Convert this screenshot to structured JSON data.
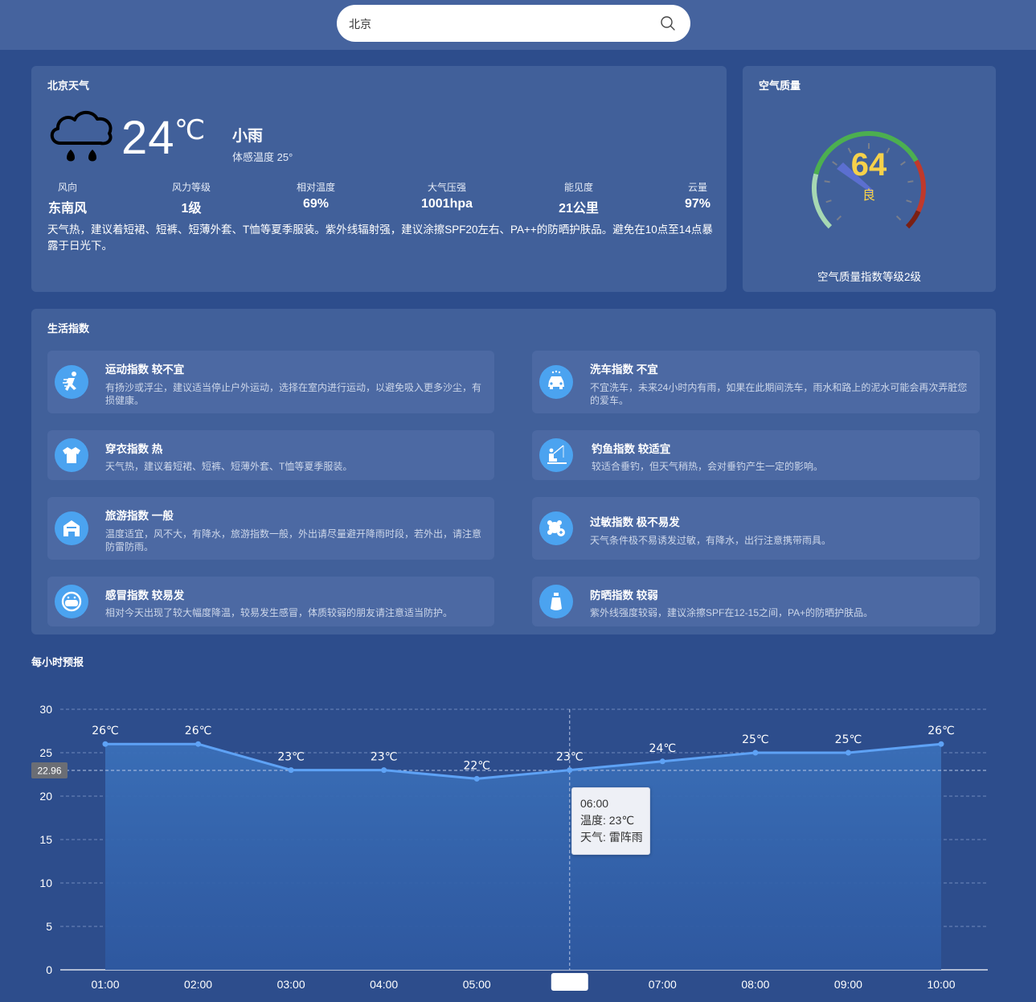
{
  "search": {
    "value": "北京"
  },
  "weather": {
    "title": "北京天气",
    "temperature": "24",
    "unit": "℃",
    "condition": "小雨",
    "feels_like": "体感温度 25°",
    "metrics": [
      {
        "label": "风向",
        "value": "东南风"
      },
      {
        "label": "风力等级",
        "value": "1级"
      },
      {
        "label": "相对温度",
        "value": "69%"
      },
      {
        "label": "大气压强",
        "value": "1001hpa"
      },
      {
        "label": "能见度",
        "value": "21公里"
      },
      {
        "label": "云量",
        "value": "97%"
      }
    ],
    "advice": "天气热，建议着短裙、短裤、短薄外套、T恤等夏季服装。紫外线辐射强，建议涂擦SPF20左右、PA++的防晒护肤品。避免在10点至14点暴露于日光下。"
  },
  "aqi": {
    "title": "空气质量",
    "value": "64",
    "level": "良",
    "description": "空气质量指数等级2级",
    "colors": {
      "good": "#4caf50",
      "light": "#a6d8b3",
      "bad": "#c0392b",
      "worse": "#7b2013",
      "value": "#f6d14a"
    }
  },
  "life": {
    "title": "生活指数",
    "items": [
      {
        "icon": "running-icon",
        "title": "运动指数 较不宜",
        "desc": "有扬沙或浮尘，建议适当停止户外运动，选择在室内进行运动，以避免吸入更多沙尘，有损健康。"
      },
      {
        "icon": "car-icon",
        "title": "洗车指数 不宜",
        "desc": "不宜洗车，未来24小时内有雨，如果在此期间洗车，雨水和路上的泥水可能会再次弄脏您的爱车。"
      },
      {
        "icon": "shirt-icon",
        "title": "穿衣指数 热",
        "desc": "天气热，建议着短裙、短裤、短薄外套、T恤等夏季服装。"
      },
      {
        "icon": "fishing-icon",
        "title": "钓鱼指数 较适宜",
        "desc": "较适合垂钓，但天气稍热，会对垂钓产生一定的影响。"
      },
      {
        "icon": "travel-icon",
        "title": "旅游指数 一般",
        "desc": "温度适宜，风不大，有降水，旅游指数一般，外出请尽量避开降雨时段，若外出，请注意防雷防雨。"
      },
      {
        "icon": "allergy-icon",
        "title": "过敏指数 极不易发",
        "desc": "天气条件极不易诱发过敏，有降水，出行注意携带雨具。"
      },
      {
        "icon": "mask-icon",
        "title": "感冒指数 较易发",
        "desc": "相对今天出现了较大幅度降温，较易发生感冒，体质较弱的朋友请注意适当防护。"
      },
      {
        "icon": "sunscreen-icon",
        "title": "防晒指数 较弱",
        "desc": "紫外线强度较弱，建议涂擦SPF在12-15之间，PA+的防晒护肤品。"
      }
    ]
  },
  "hourly": {
    "title": "每小时预报"
  },
  "tooltip": {
    "time": "06:00",
    "temp": "温度: 23℃",
    "weather": "天气: 雷阵雨"
  },
  "chart_data": {
    "type": "area",
    "x": [
      "01:00",
      "02:00",
      "03:00",
      "04:00",
      "05:00",
      "06:00",
      "07:00",
      "08:00",
      "09:00",
      "10:00"
    ],
    "series": [
      {
        "values": [
          26,
          26,
          23,
          23,
          22,
          23,
          24,
          25,
          25,
          26
        ]
      }
    ],
    "point_labels": [
      "26℃",
      "26℃",
      "23℃",
      "23℃",
      "22℃",
      "23℃",
      "24℃",
      "25℃",
      "25℃",
      "26℃"
    ],
    "yticks": [
      "0",
      "5",
      "10",
      "15",
      "20",
      "25",
      "30"
    ],
    "ylim": [
      0,
      30
    ],
    "crosshair_value": "22.96",
    "highlighted_index": 5,
    "grid": true,
    "line_color": "#5ea2f5"
  }
}
